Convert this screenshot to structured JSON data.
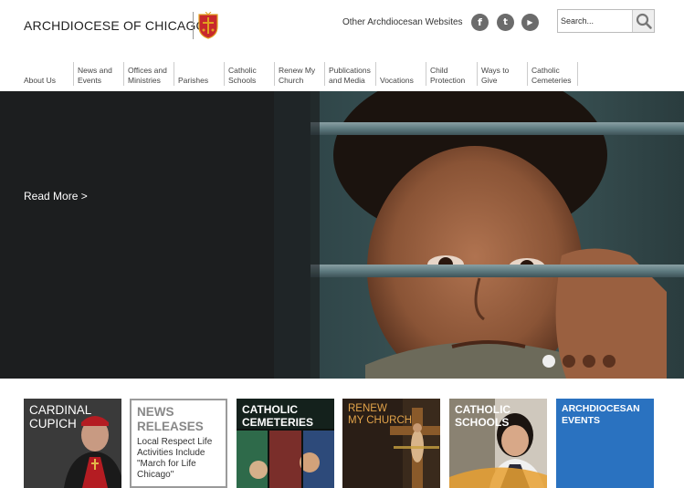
{
  "header": {
    "logo_text": "ARCHDIOCESE OF CHICAGO",
    "other_sites": "Other Archdiocesan Websites",
    "social": [
      {
        "name": "facebook",
        "glyph": "f"
      },
      {
        "name": "twitter",
        "glyph": "t"
      },
      {
        "name": "youtube",
        "glyph": "▶"
      }
    ],
    "search_placeholder": "Search..."
  },
  "nav": [
    {
      "label": "About Us"
    },
    {
      "label": "News and\nEvents"
    },
    {
      "label": "Offices and\nMinistries"
    },
    {
      "label": "Parishes"
    },
    {
      "label": "Catholic\nSchools"
    },
    {
      "label": "Renew My\nChurch"
    },
    {
      "label": "Publications\nand Media"
    },
    {
      "label": "Vocations"
    },
    {
      "label": "Child\nProtection"
    },
    {
      "label": "Ways to\nGive"
    },
    {
      "label": "Catholic\nCemeteries"
    }
  ],
  "hero": {
    "read_more": "Read More >",
    "slide_count": 4,
    "active_slide": 1
  },
  "tiles": [
    {
      "title": "CARDINAL\nCUPICH"
    },
    {
      "title": "NEWS\nRELEASES",
      "body": "Local Respect Life Activities Include \"March for Life Chicago\""
    },
    {
      "title": "CATHOLIC\nCEMETERIES"
    },
    {
      "title": "RENEW\nMY CHURCH"
    },
    {
      "title": "CATHOLIC\nSCHOOLS"
    },
    {
      "title": "ARCHDIOCESAN\nEVENTS"
    }
  ],
  "colors": {
    "crest_red": "#c8282c",
    "crest_gold": "#e0a020",
    "events_blue": "#2a72c0",
    "news_gray": "#888888"
  }
}
